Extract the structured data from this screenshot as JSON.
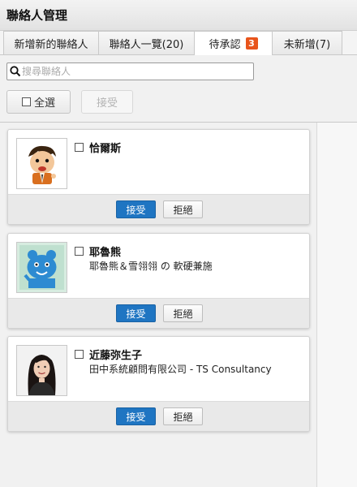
{
  "header": {
    "title": "聯絡人管理"
  },
  "tabs": [
    {
      "label": "新增新的聯絡人"
    },
    {
      "label": "聯絡人一覽(20)"
    },
    {
      "label": "待承認",
      "badge": "3"
    },
    {
      "label": "未新增(7)"
    }
  ],
  "search": {
    "placeholder": "搜尋聯絡人",
    "value": ""
  },
  "toolbar": {
    "select_all_label": "全選",
    "accept_label": "接受"
  },
  "cards": [
    {
      "name": "恰爾斯",
      "subtitle": "",
      "accept_label": "接受",
      "reject_label": "拒絕",
      "avatar": "cartoon-boy-avatar"
    },
    {
      "name": "耶魯熊",
      "subtitle": "耶魯熊＆雪翎翎 の 軟硬兼施",
      "accept_label": "接受",
      "reject_label": "拒絕",
      "avatar": "blue-bear-avatar"
    },
    {
      "name": "近藤弥生子",
      "subtitle": "田中系統顧問有限公司 - TS Consultancy",
      "accept_label": "接受",
      "reject_label": "拒絕",
      "avatar": "woman-photo-avatar"
    }
  ],
  "colors": {
    "primary": "#1f75c2",
    "badge": "#e8541b"
  }
}
